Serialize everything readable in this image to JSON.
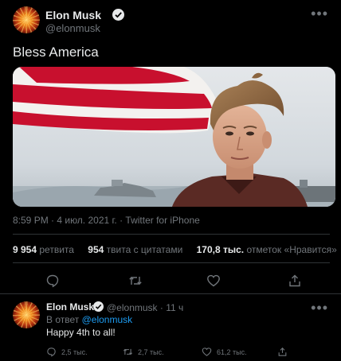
{
  "tweet": {
    "author_name": "Elon Musk",
    "handle": "@elonmusk",
    "text": "Bless America",
    "timestamp": "8:59 PM · 4 июл. 2021 г. · Twitter for iPhone",
    "stats": {
      "retweets_count": "9 954",
      "retweets_label": "ретвита",
      "quotes_count": "954",
      "quotes_label": "твита с цитатами",
      "likes_count": "170,8 тыс.",
      "likes_label": "отметок «Нравится»"
    },
    "more_icon": "more-icon",
    "verified_icon": "verified-badge-icon"
  },
  "actions": [
    "reply-icon",
    "retweet-icon",
    "like-icon",
    "share-icon"
  ],
  "reply": {
    "author_name": "Elon Musk",
    "handle": "@elonmusk",
    "time": "11 ч",
    "separator": "·",
    "in_reply_prefix": "В ответ",
    "in_reply_handle": "@elonmusk",
    "text": "Happy 4th to all!",
    "replies": "2,5 тыс.",
    "retweets": "2,7 тыс.",
    "likes": "61,2 тыс."
  },
  "colors": {
    "background": "#000000",
    "text": "#e7e9ea",
    "secondary": "#71767b",
    "accent": "#1d9bf0",
    "divider": "#2f3336"
  }
}
